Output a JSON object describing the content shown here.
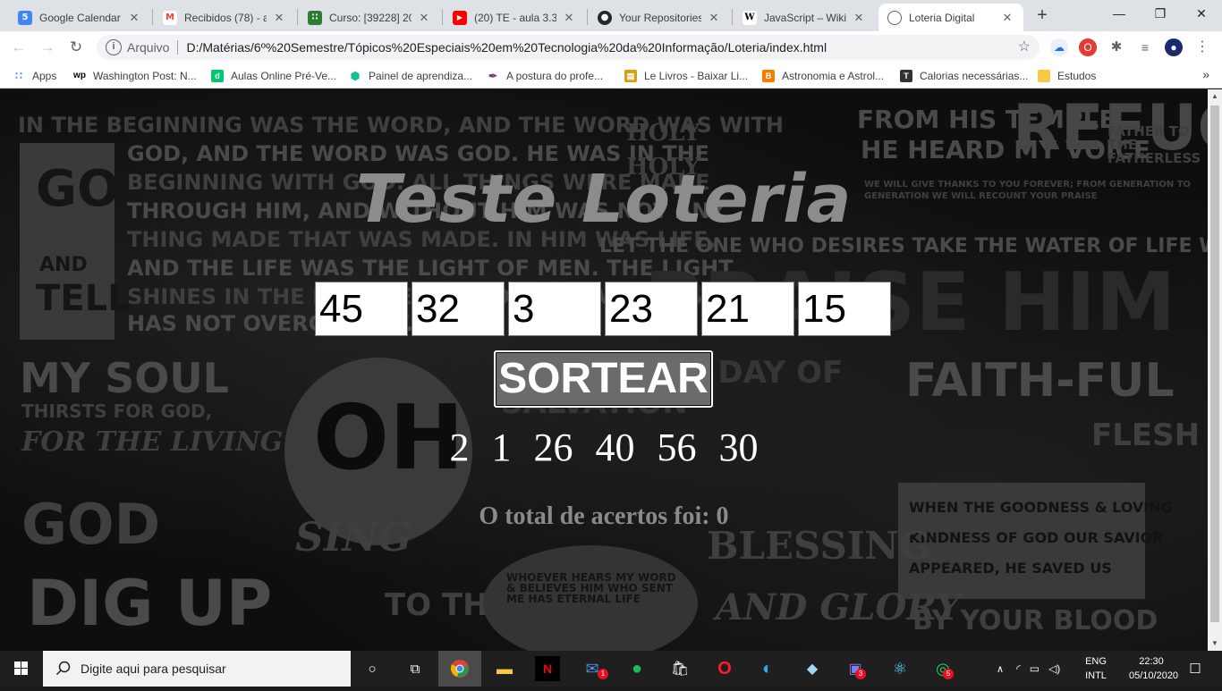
{
  "tabs": [
    {
      "title": "Google Calendar - ",
      "icon": "google-calendar-icon",
      "fav_text": "5",
      "fav_color": "#4285f4",
      "active": false
    },
    {
      "title": "Recibidos (78) - al",
      "icon": "gmail-icon",
      "fav_text": "M",
      "fav_color": "#ea4335",
      "active": false
    },
    {
      "title": "Curso: [39228] 202",
      "icon": "course-grid-icon",
      "fav_text": "∷",
      "fav_color": "#2e7d32",
      "active": false
    },
    {
      "title": "(20) TE - aula 3.3 -",
      "icon": "youtube-icon",
      "fav_text": "▶",
      "fav_color": "#ff0000",
      "active": false
    },
    {
      "title": "Your Repositories",
      "icon": "github-icon",
      "fav_text": "●",
      "fav_color": "#24292e",
      "active": false
    },
    {
      "title": "JavaScript – Wikip",
      "icon": "wikipedia-icon",
      "fav_text": "W",
      "fav_color": "#ffffff",
      "active": false
    },
    {
      "title": "Loteria Digital",
      "icon": "globe-icon",
      "fav_text": "◌",
      "fav_color": "#5f6368",
      "active": true
    }
  ],
  "window": {
    "minimize": "—",
    "maximize": "❐",
    "close": "✕",
    "new_tab": "+"
  },
  "toolbar": {
    "scheme": "Arquivo",
    "url": "D:/Matérias/6º%20Semestre/Tópicos%20Especiais%20em%20Tecnologia%20da%20Informação/Loteria/index.html"
  },
  "bookmarks": [
    {
      "label": "Apps",
      "icon": "apps-grid-icon",
      "color": "#4285f4",
      "glyph": "∷"
    },
    {
      "label": "Washington Post: N...",
      "icon": "washington-post-icon",
      "color": "#000000",
      "glyph": "wp"
    },
    {
      "label": "Aulas Online Pré-Ve...",
      "icon": "descomplica-icon",
      "color": "#00c86e",
      "glyph": "d"
    },
    {
      "label": "Painel de aprendiza...",
      "icon": "khan-academy-icon",
      "color": "#14bf96",
      "glyph": "⬢"
    },
    {
      "label": "A postura do profe...",
      "icon": "feather-icon",
      "color": "#7a3b7a",
      "glyph": "✒"
    },
    {
      "label": "Le Livros - Baixar Li...",
      "icon": "book-icon",
      "color": "#d4a017",
      "glyph": "▤"
    },
    {
      "label": "Astronomia e Astrol...",
      "icon": "blogger-icon",
      "color": "#f57d00",
      "glyph": "B"
    },
    {
      "label": "Calorias necessárias...",
      "icon": "t-site-icon",
      "color": "#333333",
      "glyph": "T"
    },
    {
      "label": "Estudos",
      "icon": "folder-icon",
      "color": "#f7c948",
      "glyph": ""
    }
  ],
  "page": {
    "title": "Teste Loteria",
    "user_numbers": [
      "45",
      "32",
      "3",
      "23",
      "21",
      "15"
    ],
    "button_label": "SORTEAR",
    "drawn_numbers": [
      "2",
      "1",
      "26",
      "40",
      "56",
      "30"
    ],
    "result_text": "O total de acertos foi: 0"
  },
  "background_text": [
    "IN THE BEGINNING WAS THE WORD, AND THE WORD WAS WITH",
    "GOD, AND THE WORD WAS GOD. HE WAS IN THE",
    "BEGINNING WITH GOD. ALL THINGS WERE MADE",
    "THROUGH HIM, AND WITHOUT HIM WAS NOT ANY",
    "THING MADE THAT WAS MADE. IN HIM WAS LIFE,",
    "AND THE LIFE WAS THE LIGHT OF MEN. THE LIGHT",
    "SHINES IN THE DARKNESS, AND THE DARKNESS",
    "HAS NOT OVERCOME IT.",
    "GO",
    "AND",
    "TELL",
    "HOLY",
    "HOLY",
    "FROM HIS TEMPLE",
    "HE HEARD MY VOICE",
    "REFUGE",
    "FATHER TO THE FATHERLESS",
    "WE WILL GIVE THANKS TO YOU FOREVER; FROM GENERATION TO GENERATION WE WILL RECOUNT YOUR PRAISE",
    "LET THE ONE WHO DESIRES TAKE THE WATER OF LIFE WITHOUT PRICE",
    "PRAISE HIM",
    "MY SOUL",
    "THIRSTS FOR GOD,",
    "FOR THE LIVING",
    "GOD",
    "OH",
    "SING",
    "TO THE",
    "NOW IS THE DAY OF SALVATION",
    "FAITH-FUL",
    "FLESH",
    "WHEN THE GOODNESS & LOVING",
    "KINDNESS OF GOD OUR SAVIOR",
    "APPEARED, HE SAVED US",
    "BLESSING",
    "AND GLORY",
    "WHOEVER HEARS MY WORD & BELIEVES HIM WHO SENT ME HAS ETERNAL LIFE",
    "DIG UP",
    "BY YOUR BLOOD"
  ],
  "taskbar": {
    "search_placeholder": "Digite aqui para pesquisar",
    "lang_1": "ENG",
    "lang_2": "INTL",
    "time": "22:30",
    "date": "05/10/2020",
    "badges": {
      "mail": "1",
      "teams": "3",
      "whatsapp": "5"
    }
  }
}
